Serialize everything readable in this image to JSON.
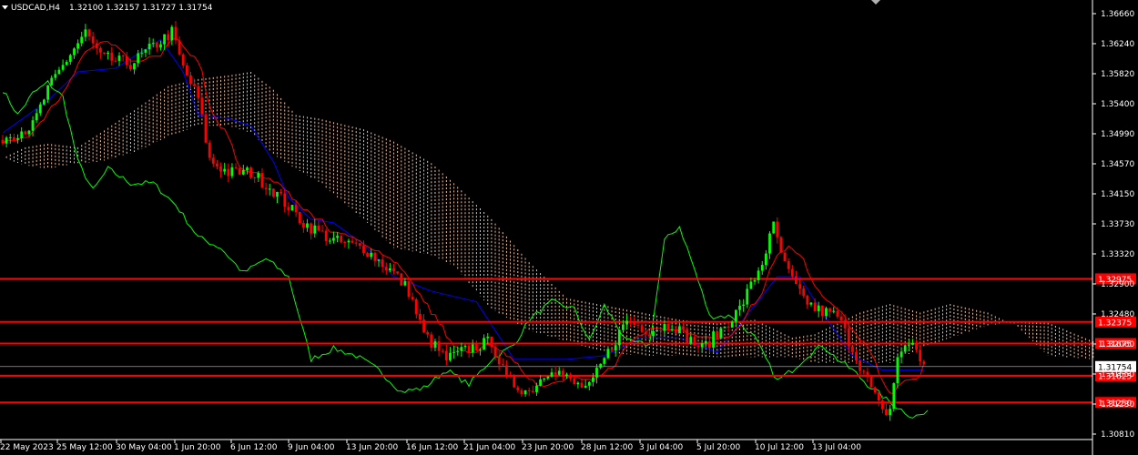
{
  "window": {
    "symbol": "USDCAD,H4",
    "ohlc": "1.32100 1.32157 1.31727 1.31754"
  },
  "chart_data": {
    "type": "candlestick",
    "ylim": [
      1.3081,
      1.3666
    ],
    "y_ticks": [
      "1.36660",
      "1.36240",
      "1.35820",
      "1.35400",
      "1.34990",
      "1.34570",
      "1.34150",
      "1.33730",
      "1.33320",
      "1.32900",
      "1.32480",
      "1.32060",
      "1.31650",
      "1.31230",
      "1.30810"
    ],
    "x_ticks": [
      "22 May 2023",
      "25 May 12:00",
      "30 May 04:00",
      "1 Jun 20:00",
      "6 Jun 12:00",
      "9 Jun 04:00",
      "13 Jun 20:00",
      "16 Jun 12:00",
      "21 Jun 04:00",
      "23 Jun 20:00",
      "28 Jun 12:00",
      "3 Jul 04:00",
      "5 Jul 20:00",
      "10 Jul 12:00",
      "13 Jul 04:00"
    ],
    "close_anchors": [
      [
        0,
        1.3493
      ],
      [
        8,
        1.351
      ],
      [
        12,
        1.356
      ],
      [
        18,
        1.361
      ],
      [
        22,
        1.364
      ],
      [
        26,
        1.3605
      ],
      [
        34,
        1.3596
      ],
      [
        40,
        1.362
      ],
      [
        45,
        1.364
      ],
      [
        48,
        1.359
      ],
      [
        52,
        1.3548
      ],
      [
        55,
        1.3462
      ],
      [
        60,
        1.3445
      ],
      [
        66,
        1.3445
      ],
      [
        72,
        1.342
      ],
      [
        80,
        1.3375
      ],
      [
        88,
        1.335
      ],
      [
        96,
        1.334
      ],
      [
        104,
        1.3305
      ],
      [
        108,
        1.328
      ],
      [
        112,
        1.322
      ],
      [
        118,
        1.3185
      ],
      [
        124,
        1.32
      ],
      [
        130,
        1.321
      ],
      [
        134,
        1.3155
      ],
      [
        140,
        1.314
      ],
      [
        146,
        1.3175
      ],
      [
        152,
        1.315
      ],
      [
        156,
        1.3145
      ],
      [
        160,
        1.3185
      ],
      [
        166,
        1.324
      ],
      [
        172,
        1.3225
      ],
      [
        178,
        1.3235
      ],
      [
        182,
        1.3215
      ],
      [
        186,
        1.32
      ],
      [
        190,
        1.322
      ],
      [
        196,
        1.3255
      ],
      [
        202,
        1.332
      ],
      [
        205,
        1.337
      ],
      [
        208,
        1.3315
      ],
      [
        212,
        1.3275
      ],
      [
        216,
        1.3255
      ],
      [
        222,
        1.3245
      ],
      [
        226,
        1.32
      ],
      [
        230,
        1.3155
      ],
      [
        234,
        1.311
      ],
      [
        236,
        1.3115
      ],
      [
        238,
        1.319
      ],
      [
        242,
        1.321
      ],
      [
        245,
        1.3175
      ]
    ],
    "ichimoku": {
      "tenkan_color": "#ff0000",
      "kijun_color": "#0000ff",
      "chikou_color": "#00ff00",
      "cloud_color": "#f4c09a",
      "kijun_anchors": [
        [
          0,
          1.35
        ],
        [
          12,
          1.3545
        ],
        [
          20,
          1.3585
        ],
        [
          30,
          1.359
        ],
        [
          42,
          1.363
        ],
        [
          48,
          1.3585
        ],
        [
          52,
          1.3525
        ],
        [
          60,
          1.352
        ],
        [
          66,
          1.351
        ],
        [
          72,
          1.346
        ],
        [
          76,
          1.341
        ],
        [
          82,
          1.338
        ],
        [
          88,
          1.3375
        ],
        [
          96,
          1.3345
        ],
        [
          104,
          1.33
        ],
        [
          114,
          1.328
        ],
        [
          126,
          1.3265
        ],
        [
          136,
          1.3185
        ],
        [
          150,
          1.3185
        ],
        [
          160,
          1.319
        ],
        [
          170,
          1.3215
        ],
        [
          180,
          1.3215
        ],
        [
          190,
          1.3195
        ],
        [
          200,
          1.326
        ],
        [
          206,
          1.33
        ],
        [
          212,
          1.33
        ],
        [
          218,
          1.325
        ],
        [
          226,
          1.319
        ],
        [
          234,
          1.317
        ],
        [
          245,
          1.317
        ]
      ],
      "chikou_anchors": [
        [
          0,
          1.356
        ],
        [
          4,
          1.3525
        ],
        [
          8,
          1.3555
        ],
        [
          12,
          1.357
        ],
        [
          16,
          1.355
        ],
        [
          18,
          1.3505
        ],
        [
          20,
          1.346
        ],
        [
          24,
          1.342
        ],
        [
          28,
          1.345
        ],
        [
          34,
          1.343
        ],
        [
          40,
          1.343
        ],
        [
          46,
          1.34
        ],
        [
          52,
          1.3355
        ],
        [
          58,
          1.334
        ],
        [
          64,
          1.3305
        ],
        [
          70,
          1.3325
        ],
        [
          76,
          1.33
        ],
        [
          82,
          1.3185
        ],
        [
          88,
          1.32
        ],
        [
          94,
          1.319
        ],
        [
          100,
          1.317
        ],
        [
          106,
          1.314
        ],
        [
          112,
          1.3145
        ],
        [
          118,
          1.317
        ],
        [
          124,
          1.315
        ],
        [
          130,
          1.3185
        ],
        [
          136,
          1.3205
        ],
        [
          140,
          1.324
        ],
        [
          146,
          1.3265
        ],
        [
          152,
          1.3255
        ],
        [
          156,
          1.321
        ],
        [
          160,
          1.326
        ],
        [
          166,
          1.321
        ],
        [
          172,
          1.3205
        ],
        [
          176,
          1.335
        ],
        [
          180,
          1.337
        ],
        [
          184,
          1.331
        ],
        [
          188,
          1.3245
        ],
        [
          194,
          1.3245
        ],
        [
          200,
          1.3215
        ],
        [
          206,
          1.3155
        ],
        [
          210,
          1.317
        ],
        [
          214,
          1.319
        ],
        [
          218,
          1.3205
        ],
        [
          222,
          1.3185
        ],
        [
          226,
          1.317
        ],
        [
          230,
          1.315
        ],
        [
          236,
          1.3125
        ],
        [
          242,
          1.3105
        ],
        [
          246,
          1.311
        ]
      ],
      "span_a_anchors": [
        [
          0,
          1.3465
        ],
        [
          6,
          1.348
        ],
        [
          12,
          1.3485
        ],
        [
          20,
          1.348
        ],
        [
          26,
          1.35
        ],
        [
          36,
          1.3535
        ],
        [
          44,
          1.3565
        ],
        [
          52,
          1.3575
        ],
        [
          60,
          1.358
        ],
        [
          66,
          1.3585
        ],
        [
          72,
          1.356
        ],
        [
          78,
          1.3525
        ],
        [
          84,
          1.352
        ],
        [
          96,
          1.3505
        ],
        [
          104,
          1.3488
        ],
        [
          114,
          1.3458
        ],
        [
          120,
          1.343
        ],
        [
          130,
          1.338
        ],
        [
          140,
          1.332
        ],
        [
          150,
          1.327
        ],
        [
          160,
          1.326
        ],
        [
          170,
          1.325
        ],
        [
          180,
          1.324
        ],
        [
          190,
          1.3235
        ],
        [
          200,
          1.324
        ],
        [
          210,
          1.3215
        ],
        [
          216,
          1.322
        ],
        [
          222,
          1.3235
        ],
        [
          228,
          1.325
        ],
        [
          236,
          1.3262
        ],
        [
          244,
          1.325
        ],
        [
          252,
          1.3262
        ],
        [
          262,
          1.325
        ],
        [
          270,
          1.323
        ],
        [
          278,
          1.319
        ],
        [
          290,
          1.3185
        ]
      ],
      "span_b_anchors": [
        [
          0,
          1.3465
        ],
        [
          6,
          1.3455
        ],
        [
          12,
          1.345
        ],
        [
          20,
          1.3458
        ],
        [
          26,
          1.346
        ],
        [
          36,
          1.3475
        ],
        [
          44,
          1.3495
        ],
        [
          52,
          1.351
        ],
        [
          60,
          1.351
        ],
        [
          66,
          1.35
        ],
        [
          72,
          1.347
        ],
        [
          78,
          1.345
        ],
        [
          84,
          1.3432
        ],
        [
          96,
          1.338
        ],
        [
          104,
          1.334
        ],
        [
          114,
          1.333
        ],
        [
          120,
          1.3315
        ],
        [
          130,
          1.3255
        ],
        [
          140,
          1.3225
        ],
        [
          150,
          1.321
        ],
        [
          160,
          1.3195
        ],
        [
          170,
          1.319
        ],
        [
          180,
          1.319
        ],
        [
          190,
          1.3188
        ],
        [
          200,
          1.3188
        ],
        [
          210,
          1.3188
        ],
        [
          216,
          1.318
        ],
        [
          222,
          1.318
        ],
        [
          228,
          1.318
        ],
        [
          236,
          1.318
        ],
        [
          244,
          1.32
        ],
        [
          252,
          1.3215
        ],
        [
          262,
          1.3232
        ],
        [
          270,
          1.3238
        ],
        [
          278,
          1.3236
        ],
        [
          290,
          1.321
        ]
      ]
    },
    "hlines": [
      {
        "value": 1.3297,
        "label": "1.32975",
        "color": "#ff0000"
      },
      {
        "value": 1.3237,
        "label": "1.32375",
        "color": "#ff0000"
      },
      {
        "value": 1.3207,
        "label": "1.31675",
        "color": "#ff0000"
      },
      {
        "value": 1.3162,
        "label": "1.31625",
        "color": "#ff0000"
      },
      {
        "value": 1.3125,
        "label": "1.31250",
        "color": "#ff0000"
      }
    ],
    "current_price": {
      "value": 1.3175,
      "label": "1.31754",
      "color": "#ffffff"
    },
    "bull_color": "#00ff00",
    "bear_color": "#ff0000",
    "grid": false
  }
}
